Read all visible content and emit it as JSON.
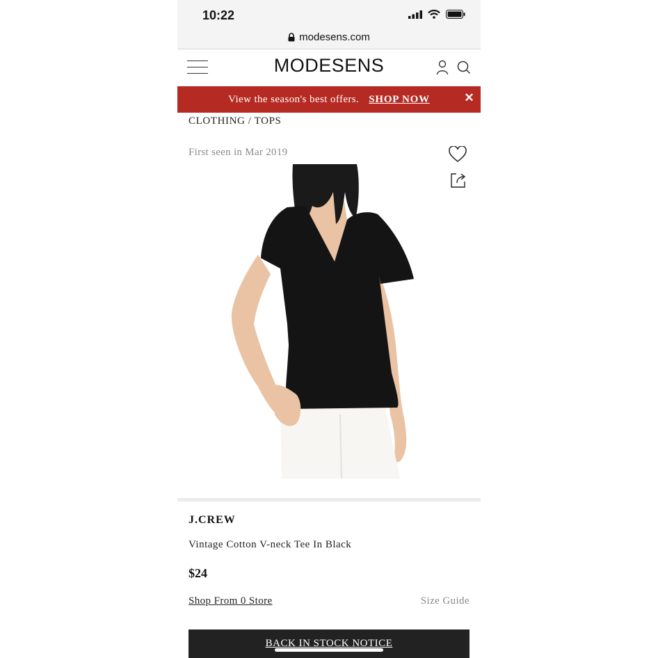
{
  "status_bar": {
    "time": "10:22"
  },
  "browser": {
    "url": "modesens.com"
  },
  "header": {
    "logo": "MODESENS"
  },
  "promo": {
    "text": "View the season's best offers.",
    "cta": "SHOP NOW",
    "close": "✕"
  },
  "breadcrumb": "CLOTHING / TOPS",
  "product": {
    "first_seen": "First seen in Mar 2019",
    "brand": "J.CREW",
    "name": "Vintage Cotton V-neck Tee In Black",
    "price": "$24",
    "shop_from": "Shop From 0 Store",
    "size_guide": "Size Guide",
    "stock_button": "BACK IN STOCK NOTICE"
  },
  "colors": {
    "promo_bg": "#b52a22",
    "button_bg": "#222222"
  }
}
